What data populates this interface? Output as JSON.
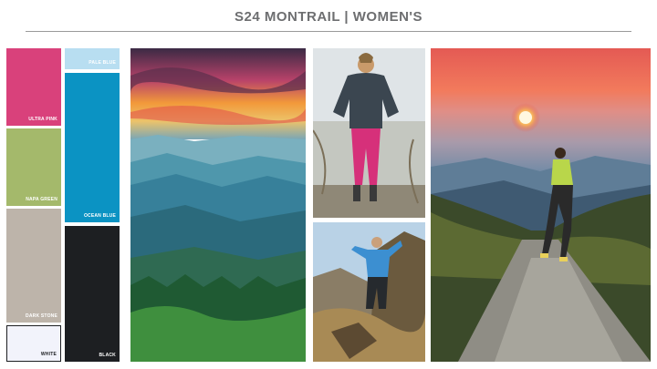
{
  "header": {
    "title": "S24 MONTRAIL | WOMEN'S"
  },
  "swatches": [
    {
      "label": "ULTRA PINK",
      "color": "#d9417b"
    },
    {
      "label": "PALE BLUE",
      "color": "#b8def1"
    },
    {
      "label": "NAPA GREEN",
      "color": "#a4b96b"
    },
    {
      "label": "OCEAN BLUE",
      "color": "#0b93c3"
    },
    {
      "label": "DARK STONE",
      "color": "#bdb4aa"
    },
    {
      "label": "WHITE",
      "color": "#f2f3fb"
    },
    {
      "label": "BLACK",
      "color": "#1d1f22"
    }
  ]
}
